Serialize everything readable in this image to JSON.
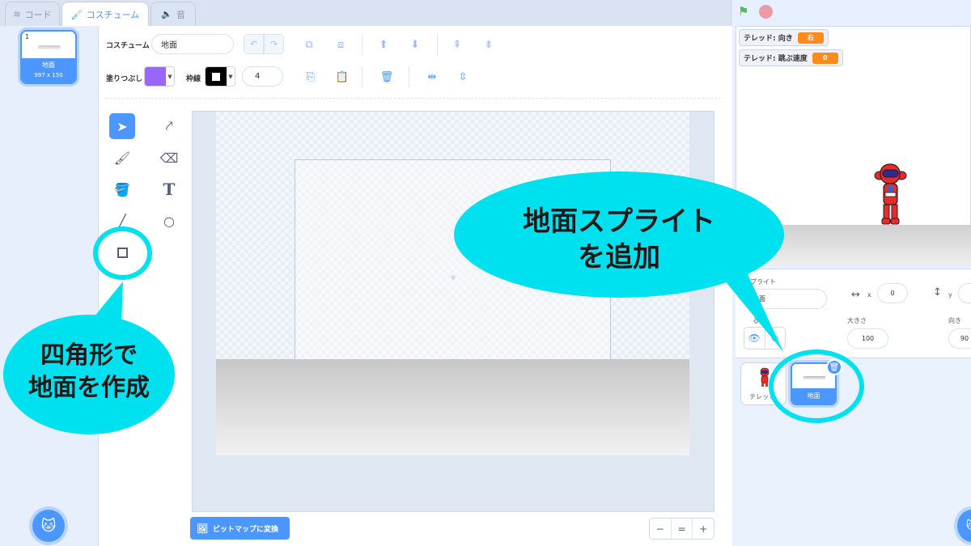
{
  "tabs": [
    {
      "label": "コード",
      "icon": "code-blocks-icon"
    },
    {
      "label": "コスチューム",
      "icon": "brush-icon"
    },
    {
      "label": "音",
      "icon": "speaker-icon"
    }
  ],
  "costume_list": {
    "items": [
      {
        "index": "1",
        "name": "地面",
        "size": "997 x 150"
      }
    ]
  },
  "toolbar": {
    "costume_label": "コスチューム",
    "costume_name": "地面",
    "fill_label": "塗りつぶし",
    "fill_color": "#9966ff",
    "outline_label": "枠線",
    "outline_color": "#000000",
    "outline_width": "4"
  },
  "bottom": {
    "bitmap_label": "ビットマップに変換",
    "zoom_out": "−",
    "zoom_reset": "=",
    "zoom_in": "+"
  },
  "stage": {
    "monitors": [
      {
        "label": "テレッド: 向き",
        "value": "右"
      },
      {
        "label": "テレッド: 跳ぶ速度",
        "value": "0"
      }
    ]
  },
  "sprite_info": {
    "sprite_label": "スプライト",
    "sprite_name": "地面",
    "x_label": "x",
    "x_value": "0",
    "y_label": "y",
    "show_label": "る",
    "size_label": "大きさ",
    "size_value": "100",
    "direction_label": "向き",
    "direction_value": "90"
  },
  "sprites": [
    {
      "name": "テレッド"
    },
    {
      "name": "地面"
    }
  ],
  "annotations": {
    "left_bubble_line1": "四角形で",
    "left_bubble_line2": "地面を作成",
    "right_bubble_line1": "地面スプライト",
    "right_bubble_line2": "を追加"
  },
  "colors": {
    "accent": "#4c97ff",
    "callout": "#00e1f0",
    "monitor_value": "#ff8c1a"
  }
}
